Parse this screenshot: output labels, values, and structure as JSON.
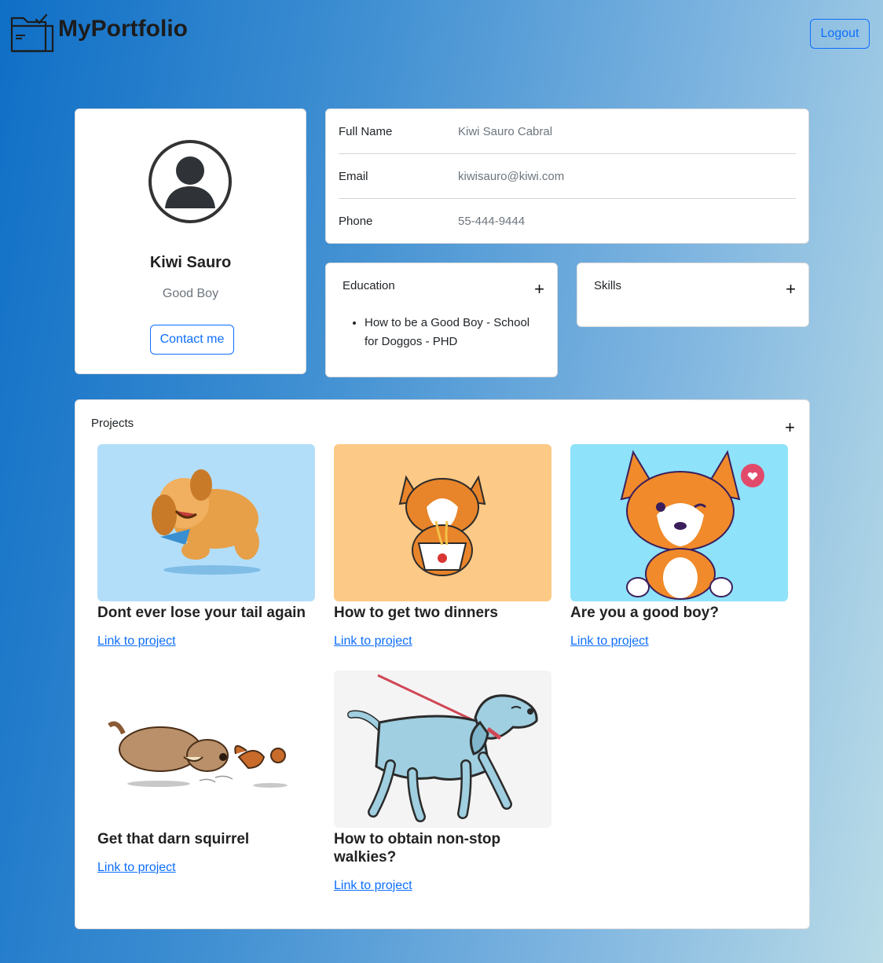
{
  "header": {
    "brand": "MyPortfolio",
    "logout_label": "Logout"
  },
  "profile": {
    "name": "Kiwi Sauro",
    "title": "Good Boy",
    "contact_label": "Contact me"
  },
  "info": [
    {
      "label": "Full Name",
      "value": "Kiwi Sauro Cabral"
    },
    {
      "label": "Email",
      "value": "kiwisauro@kiwi.com"
    },
    {
      "label": "Phone",
      "value": "55-444-9444"
    }
  ],
  "education": {
    "title": "Education",
    "add_label": "+",
    "items": [
      "How to be a Good Boy - School for Doggos - PHD"
    ]
  },
  "skills": {
    "title": "Skills",
    "add_label": "+"
  },
  "projects": {
    "title": "Projects",
    "add_label": "+",
    "items": [
      {
        "title": "Dont ever lose your tail again",
        "link": "Link to project",
        "image": "jumping-dog-illustration",
        "bg": "#b3defa"
      },
      {
        "title": "How to get two dinners",
        "link": "Link to project",
        "image": "corgi-eating-noodles-illustration",
        "bg": "#fdc986"
      },
      {
        "title": "Are you a good boy?",
        "link": "Link to project",
        "image": "winking-corgi-illustration",
        "bg": "#8ee2fa"
      },
      {
        "title": "Get that darn squirrel",
        "link": "Link to project",
        "image": "dog-chasing-squirrel-illustration",
        "bg": "#ffffff"
      },
      {
        "title": "How to obtain non-stop walkies?",
        "link": "Link to project",
        "image": "blue-dog-on-leash-illustration",
        "bg": "#f4f4f4"
      }
    ]
  }
}
